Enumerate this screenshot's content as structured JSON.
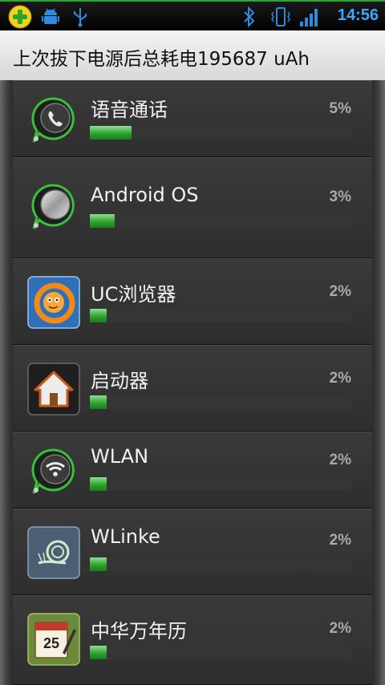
{
  "status_bar": {
    "time": "14:56",
    "icons": [
      "app-360-icon",
      "android-debug-icon",
      "usb-icon",
      "bluetooth-icon",
      "vibrate-icon",
      "signal-icon"
    ]
  },
  "header": {
    "title": "上次拔下电源后总耗电195687 uAh"
  },
  "colors": {
    "accent_time": "#39a6ff",
    "bar_green": "#2fa32f",
    "row_bg": "#343434"
  },
  "items": [
    {
      "name": "语音通话",
      "percent_label": "5%",
      "percent": 5,
      "icon": "phone-icon"
    },
    {
      "name": "Android OS",
      "percent_label": "3%",
      "percent": 3,
      "icon": "android-os-icon"
    },
    {
      "name": "UC浏览器",
      "percent_label": "2%",
      "percent": 2,
      "icon": "uc-browser-icon"
    },
    {
      "name": "启动器",
      "percent_label": "2%",
      "percent": 2,
      "icon": "launcher-home-icon"
    },
    {
      "name": "WLAN",
      "percent_label": "2%",
      "percent": 2,
      "icon": "wifi-icon"
    },
    {
      "name": "WLinke",
      "percent_label": "2%",
      "percent": 2,
      "icon": "wlinke-snail-icon"
    },
    {
      "name": "中华万年历",
      "percent_label": "2%",
      "percent": 2,
      "icon": "calendar-icon"
    }
  ]
}
